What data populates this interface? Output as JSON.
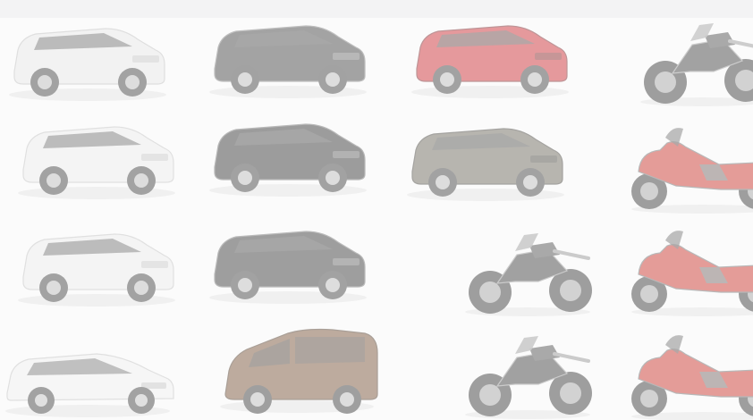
{
  "vehicles": [
    {
      "kind": "suv",
      "color": "#e8e8e8",
      "accent": "#b9b9b9",
      "icon": "white-suv-icon"
    },
    {
      "kind": "suv",
      "color": "#2c2c2c",
      "accent": "#6b6b6b",
      "icon": "black-suv-icon"
    },
    {
      "kind": "suv",
      "color": "#c8141b",
      "accent": "#6b0a0e",
      "icon": "red-suv-icon"
    },
    {
      "kind": "moto",
      "color": "#2a2a2a",
      "accent": "#8f8f8f",
      "icon": "adventure-motorcycle-icon"
    },
    {
      "kind": "suv",
      "color": "#ececec",
      "accent": "#bdbdbd",
      "icon": "white-suv-icon"
    },
    {
      "kind": "suv",
      "color": "#1c1c1c",
      "accent": "#5e5e5e",
      "icon": "black-suv-icon"
    },
    {
      "kind": "suv",
      "color": "#5c5648",
      "accent": "#2f2c25",
      "icon": "bronze-suv-icon"
    },
    {
      "kind": "tour",
      "color": "#c61b12",
      "accent": "#5d5d5d",
      "icon": "touring-motorcycle-icon"
    },
    {
      "kind": "suv",
      "color": "#ebebeb",
      "accent": "#bcbcbc",
      "icon": "white-suv-icon"
    },
    {
      "kind": "suv",
      "color": "#202020",
      "accent": "#616161",
      "icon": "black-suv-icon"
    },
    {
      "kind": "moto",
      "color": "#262626",
      "accent": "#8a8a8a",
      "icon": "adventure-motorcycle-icon"
    },
    {
      "kind": "tour",
      "color": "#c51a12",
      "accent": "#5d5d5d",
      "icon": "touring-motorcycle-icon"
    },
    {
      "kind": "wagon",
      "color": "#f0f0f0",
      "accent": "#bdbdbd",
      "icon": "white-wagon-icon"
    },
    {
      "kind": "van",
      "color": "#6a3f1f",
      "accent": "#3a220f",
      "icon": "brown-van-icon"
    },
    {
      "kind": "moto",
      "color": "#262626",
      "accent": "#8a8a8a",
      "icon": "adventure-motorcycle-icon"
    },
    {
      "kind": "tour",
      "color": "#c51a12",
      "accent": "#5d5d5d",
      "icon": "touring-motorcycle-icon"
    }
  ]
}
